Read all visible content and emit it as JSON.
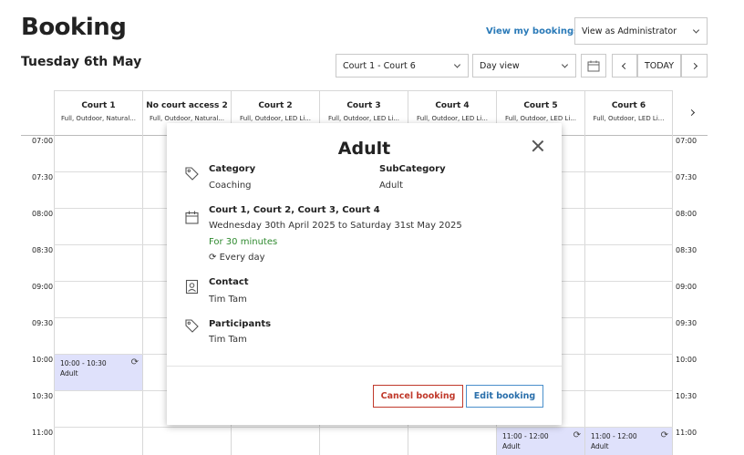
{
  "header": {
    "title": "Booking",
    "date": "Tuesday 6th May",
    "my_bookings_link": "View my bookings >",
    "view_as": "View as Administrator",
    "court_filter": "Court 1 - Court 6",
    "view_mode": "Day view",
    "today_label": "TODAY"
  },
  "columns": [
    {
      "name": "Court 1",
      "sub": "Full, Outdoor, Natural..."
    },
    {
      "name": "No court access 2",
      "sub": "Full, Outdoor, Natural..."
    },
    {
      "name": "Court 2",
      "sub": "Full, Outdoor, LED Li..."
    },
    {
      "name": "Court 3",
      "sub": "Full, Outdoor, LED Li..."
    },
    {
      "name": "Court 4",
      "sub": "Full, Outdoor, LED Li..."
    },
    {
      "name": "Court 5",
      "sub": "Full, Outdoor, LED Li..."
    },
    {
      "name": "Court 6",
      "sub": "Full, Outdoor, LED Li..."
    }
  ],
  "times": [
    "07:00",
    "07:30",
    "08:00",
    "08:30",
    "09:00",
    "09:30",
    "10:00",
    "10:30",
    "11:00"
  ],
  "events": [
    {
      "time": "10:00 - 10:30",
      "label": "Adult"
    },
    {
      "time": "11:00 - 12:00",
      "label": "Adult"
    },
    {
      "time": "11:00 - 12:00",
      "label": "Adult"
    }
  ],
  "modal": {
    "title": "Adult",
    "category_label": "Category",
    "category_value": "Coaching",
    "subcategory_label": "SubCategory",
    "subcategory_value": "Adult",
    "courts": "Court 1, Court 2, Court 3, Court 4",
    "date_range": "Wednesday 30th April 2025 to Saturday 31st May 2025",
    "duration": "For 30 minutes",
    "recurrence": "Every day",
    "contact_label": "Contact",
    "contact_value": "Tim Tam",
    "participants_label": "Participants",
    "participants_value": "Tim Tam",
    "cancel_label": "Cancel booking",
    "edit_label": "Edit booking"
  },
  "colors": {
    "link": "#2a7ab8",
    "event_bg": "#dfe1fb",
    "cancel": "#c0392b",
    "edit": "#2a6fab",
    "duration": "#2f8a2f"
  }
}
